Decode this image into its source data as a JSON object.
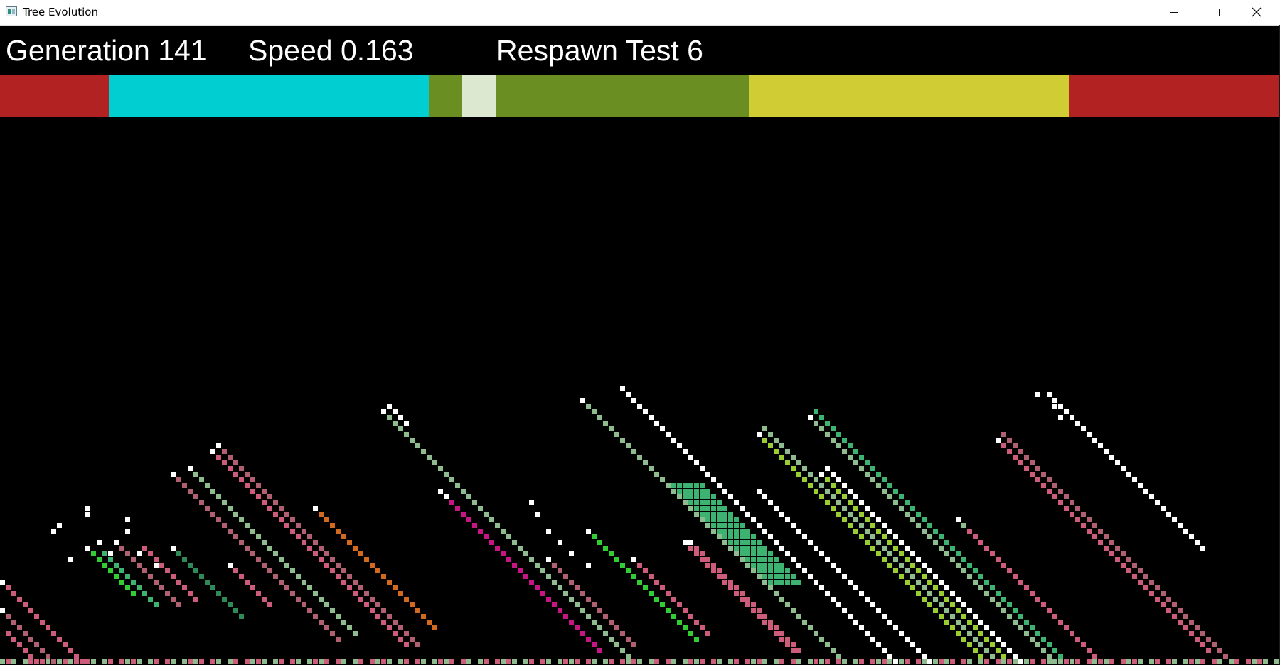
{
  "window": {
    "title": "Tree Evolution",
    "icon": "app-window-icon",
    "controls": [
      "minimize-icon",
      "maximize-icon",
      "close-icon"
    ]
  },
  "hud": {
    "generation": "Generation 141",
    "speed": "Speed 0.163",
    "respawn": "Respawn Test 6"
  },
  "genome_strip": [
    {
      "color": "#b22222",
      "fraction": 0.085
    },
    {
      "color": "#00ced1",
      "fraction": 0.25
    },
    {
      "color": "#6b8e23",
      "fraction": 0.026
    },
    {
      "color": "#dde8d0",
      "fraction": 0.026
    },
    {
      "color": "#6b8e23",
      "fraction": 0.198
    },
    {
      "color": "#d0cc33",
      "fraction": 0.25
    },
    {
      "color": "#b22222",
      "fraction": 0.165
    }
  ],
  "palette": {
    "white": "#ffffff",
    "mint": "#3cb371",
    "pale_green": "#8fbc8f",
    "sea_green": "#2e8b57",
    "pink": "#cd5c7a",
    "rose": "#b06070",
    "magenta": "#c71585",
    "orange": "#d2691e",
    "lime": "#9acd32",
    "bright_green": "#32cd32",
    "olive": "#6b8e23"
  }
}
